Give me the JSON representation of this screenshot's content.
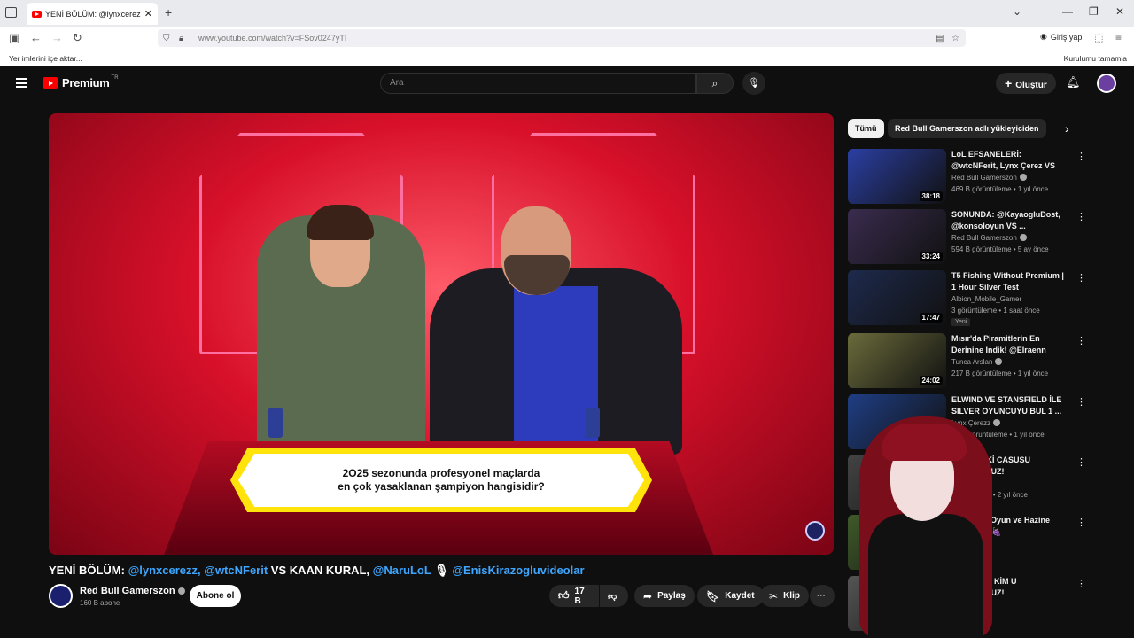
{
  "browser": {
    "tab_title": "YENİ BÖLÜM: @lynxcerezz, @w",
    "url": "www.youtube.com/watch?v=FSov0247yTI",
    "signin_label": "Giriş yap",
    "bookmarks_import": "Yer imlerini içe aktar...",
    "install_label": "Kurulumu tamamla"
  },
  "header": {
    "logo_text": "Premium",
    "logo_region": "TR",
    "search_placeholder": "Ara",
    "create_label": "Oluştur"
  },
  "video": {
    "question_line1": "2O25 sezonunda profesyonel maçlarda",
    "question_line2": "en çok yasaklanan şampiyon hangisidir?",
    "title_prefix": "YENİ BÖLÜM:",
    "title_link1": "@lynxcerezz,",
    "title_link2": "@wtcNFerit",
    "title_mid": "VS KAAN KURAL,",
    "title_link3": "@NaruLoL",
    "title_link4": "@EnisKirazogluvideolar",
    "channel": "Red Bull Gamerszon",
    "subscribers": "160 B abone",
    "subscribe_label": "Abone ol",
    "likes": "17 B",
    "share_label": "Paylaş",
    "save_label": "Kaydet",
    "clip_label": "Klip"
  },
  "chips": {
    "all": "Tümü",
    "uploader": "Red Bull Gamerszon adlı yükleyiciden"
  },
  "recommendations": [
    {
      "title": "LoL EFSANELERİ: @wtcNFerit, Lynx Çerez VS @NaruLoL, ...",
      "channel": "Red Bull Gamerszon",
      "meta": "469 B görüntüleme • 1 yıl önce",
      "duration": "38:18"
    },
    {
      "title": "SONUNDA: @KayaogluDost, @konsoloyun VS ...",
      "channel": "Red Bull Gamerszon",
      "meta": "594 B görüntüleme • 5 ay önce",
      "duration": "33:24"
    },
    {
      "title": "T5 Fishing Without Premium | 1 Hour Silver Test",
      "channel": "Albion_Mobile_Gamer",
      "meta": "3 görüntüleme • 1 saat önce",
      "duration": "17:47",
      "badge": "Yeni"
    },
    {
      "title": "Mısır'da Piramitlerin En Derinine İndik! @Elraenn @Batuhan ...",
      "channel": "Tunca Arslan",
      "meta": "217 B görüntüleme • 1 yıl önce",
      "duration": "24:02"
    },
    {
      "title": "ELWIND VE STANSFIELD İLE SILVER OYUNCUYU BUL 1 ...",
      "channel": "Lynx Çerezz",
      "meta": "74 B görüntüleme • 1 yıl önce",
      "duration": ""
    },
    {
      "title": "İÇİMİZDEKİ CASUSU BULUYORUZ!",
      "channel": "layer",
      "meta": "görüntüleme • 2 yıl önce",
      "duration": ""
    },
    {
      "title": "En Büyük Oyun ve Hazine Gittim! 🇰🇷 🍇",
      "channel": "",
      "meta": "1 yıl önce",
      "duration": ""
    },
    {
      "title": "SORARAK KİM U BULUYORUZ!",
      "channel": "",
      "meta": "",
      "duration": ""
    }
  ],
  "thumb_colors": [
    "#2b3fa3",
    "#3a2c4f",
    "#1e2a4d",
    "#6b6b3c",
    "#1f3e84",
    "#444",
    "#3f5a2a",
    "#555"
  ]
}
